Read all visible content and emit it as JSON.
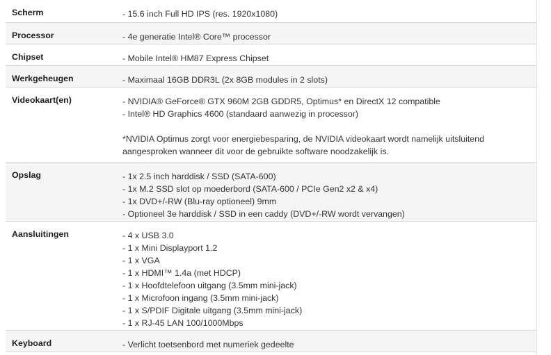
{
  "specs": {
    "scherm": {
      "label": "Scherm",
      "lines": [
        "- 15.6 inch Full HD IPS (res. 1920x1080)"
      ]
    },
    "processor": {
      "label": "Processor",
      "lines": [
        "- 4e generatie Intel® Core™ processor"
      ]
    },
    "chipset": {
      "label": "Chipset",
      "lines": [
        "- Mobile Intel® HM87 Express Chipset"
      ]
    },
    "werkgeheugen": {
      "label": "Werkgeheugen",
      "lines": [
        "- Maximaal 16GB DDR3L (2x 8GB modules in 2 slots)"
      ]
    },
    "videokaart": {
      "label": "Videokaart(en)",
      "lines": [
        "- NVIDIA® GeForce® GTX 960M 2GB GDDR5, Optimus* en DirectX 12 compatible",
        "- Intel® HD Graphics 4600 (standaard aanwezig in processor)"
      ],
      "note": "*NVIDIA Optimus zorgt voor energiebesparing, de NVIDIA videokaart wordt namelijk uitsluitend aangesproken wanneer dit voor de gebruikte software noodzakelijk is."
    },
    "opslag": {
      "label": "Opslag",
      "lines": [
        "- 1x 2.5 inch harddisk / SSD (SATA-600)",
        "- 1x M.2 SSD slot op moederbord (SATA-600 / PCIe Gen2 x2 & x4)",
        "- 1x DVD+/-RW (Blu-ray optioneel) 9mm",
        "- Optioneel 3e harddisk / SSD in een caddy (DVD+/-RW wordt vervangen)"
      ]
    },
    "aansluitingen": {
      "label": "Aansluitingen",
      "lines": [
        "- 4 x USB 3.0",
        "- 1 x Mini Displayport 1.2",
        "- 1 x VGA",
        "- 1 x HDMI™ 1.4a (met HDCP)",
        "- 1 x Hoofdtelefoon uitgang (3.5mm mini-jack)",
        "- 1 x Microfoon ingang (3.5mm mini-jack)",
        "- 1 x S/PDIF Digitale uitgang (3.5mm mini-jack)",
        "- 1 x RJ-45 LAN 100/1000Mbps"
      ]
    },
    "keyboard": {
      "label": "Keyboard",
      "lines": [
        "- Verlicht toetsenbord met numeriek gedeelte"
      ]
    }
  }
}
